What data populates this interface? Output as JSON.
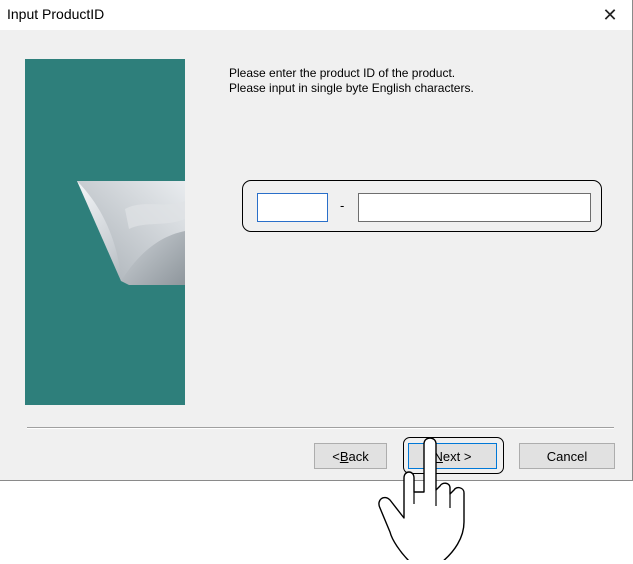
{
  "window": {
    "title": "Input ProductID",
    "close_glyph": "✕"
  },
  "instructions": {
    "line1": "Please enter the product ID of the product.",
    "line2": "Please input in single byte English characters."
  },
  "product_id": {
    "part1_value": "",
    "separator": "-",
    "part2_value": ""
  },
  "buttons": {
    "back_prefix": "< ",
    "back_mnemonic": "B",
    "back_rest": "ack",
    "next_mnemonic": "N",
    "next_rest": "ext >",
    "cancel": "Cancel"
  },
  "colors": {
    "banner": "#2e7f7b",
    "dialog_bg": "#f0f0f0",
    "focus_border": "#2a6fc9",
    "default_button_border": "#0078d7"
  },
  "icons": {
    "close": "close-icon",
    "banner_art": "curled-page-graphic",
    "pointer": "pointing-hand-icon"
  }
}
